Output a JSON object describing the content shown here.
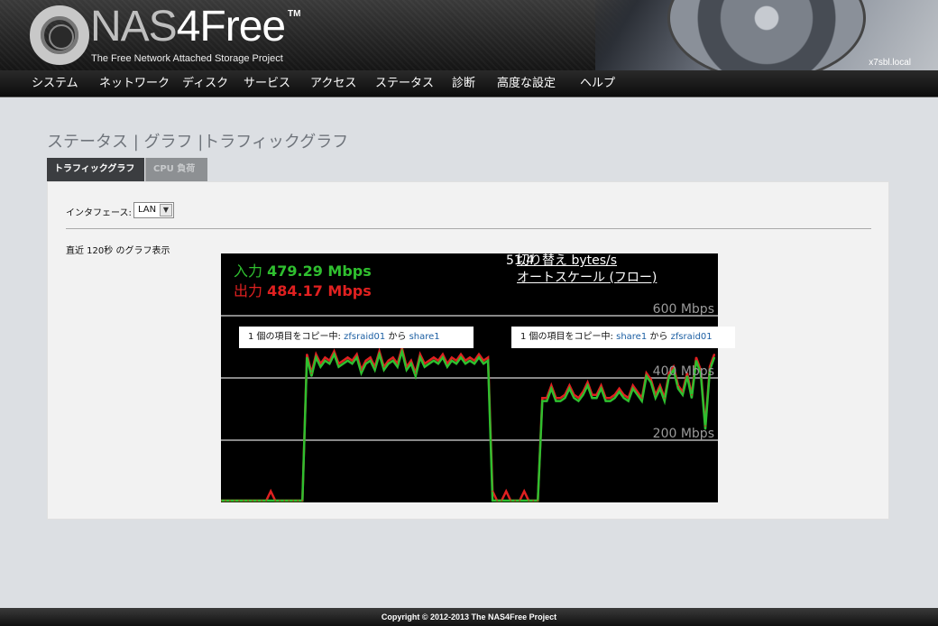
{
  "header": {
    "logo_nas": "NAS",
    "logo_free": "4Free",
    "logo_tm": "TM",
    "tagline": "The Free Network Attached Storage Project",
    "hostname": "x7sbl.local"
  },
  "nav": {
    "items": [
      "システム",
      "ネットワーク",
      "ディスク",
      "サービス",
      "アクセス",
      "ステータス",
      "診断",
      "高度な設定",
      "ヘルプ"
    ]
  },
  "page": {
    "breadcrumb": "ステータス | グラフ |トラフィックグラフ",
    "tabs": [
      "トラフィックグラフ",
      "CPU 負荷"
    ],
    "active_tab": 0
  },
  "panel": {
    "interface_label": "インタフェース:",
    "interface_value": "LAN",
    "range_label": "直近 120秒 のグラフ表示"
  },
  "graph": {
    "in_label": "入力",
    "in_value": "479.29 Mbps",
    "out_label": "出力",
    "out_value": "484.17 Mbps",
    "toggle_a": "51.4",
    "toggle_b": "切り替え bytes/s",
    "autoscale": "オートスケール (フロー)",
    "tick_600": "600 Mbps",
    "tick_400": "400 Mbps",
    "tick_200": "200 Mbps",
    "copy_left": {
      "prefix": "1 個の項目をコピー中:",
      "src": "zfsraid01",
      "mid": "から",
      "dst": "share1"
    },
    "copy_right": {
      "prefix": "1 個の項目をコピー中:",
      "src": "share1",
      "mid": "から",
      "dst": "zfsraid01"
    },
    "colors": {
      "in": "#2fbf2f",
      "out": "#e02020",
      "grid": "#888888",
      "bg": "#000000"
    }
  },
  "chart_data": {
    "type": "line",
    "xlabel": "",
    "ylabel": "",
    "ylim": [
      0,
      800
    ],
    "yticks": [
      200,
      400,
      600
    ],
    "series": [
      {
        "name": "入力",
        "values": [
          0,
          0,
          0,
          0,
          0,
          0,
          0,
          0,
          0,
          0,
          0,
          0,
          0,
          0,
          0,
          0,
          0,
          0,
          0,
          460,
          400,
          460,
          430,
          450,
          440,
          470,
          430,
          440,
          450,
          440,
          460,
          410,
          440,
          450,
          420,
          470,
          420,
          440,
          450,
          430,
          480,
          420,
          440,
          400,
          460,
          430,
          440,
          450,
          440,
          460,
          430,
          450,
          440,
          460,
          440,
          450,
          440,
          460,
          440,
          450,
          0,
          0,
          0,
          0,
          0,
          0,
          0,
          0,
          0,
          0,
          0,
          320,
          320,
          360,
          320,
          320,
          330,
          360,
          330,
          320,
          340,
          370,
          330,
          330,
          360,
          320,
          320,
          330,
          350,
          330,
          320,
          360,
          340,
          320,
          400,
          380,
          330,
          360,
          320,
          400,
          420,
          360,
          340,
          400,
          330,
          450,
          410,
          230,
          420,
          460
        ]
      },
      {
        "name": "出力",
        "values": [
          0,
          0,
          0,
          0,
          0,
          0,
          0,
          0,
          0,
          0,
          0,
          30,
          0,
          0,
          0,
          0,
          0,
          0,
          0,
          470,
          410,
          470,
          440,
          460,
          450,
          480,
          440,
          450,
          460,
          450,
          470,
          420,
          450,
          460,
          430,
          480,
          430,
          450,
          460,
          440,
          490,
          430,
          450,
          410,
          470,
          440,
          450,
          460,
          450,
          470,
          440,
          460,
          450,
          470,
          450,
          460,
          450,
          470,
          450,
          460,
          30,
          0,
          0,
          30,
          0,
          0,
          0,
          30,
          0,
          0,
          0,
          330,
          330,
          370,
          330,
          330,
          340,
          370,
          340,
          330,
          350,
          380,
          340,
          340,
          370,
          330,
          330,
          340,
          360,
          340,
          330,
          370,
          350,
          330,
          410,
          390,
          340,
          370,
          330,
          410,
          430,
          370,
          350,
          410,
          340,
          460,
          420,
          240,
          430,
          470
        ]
      }
    ]
  },
  "footer": {
    "copyright": "Copyright © 2012-2013 The NAS4Free Project"
  }
}
